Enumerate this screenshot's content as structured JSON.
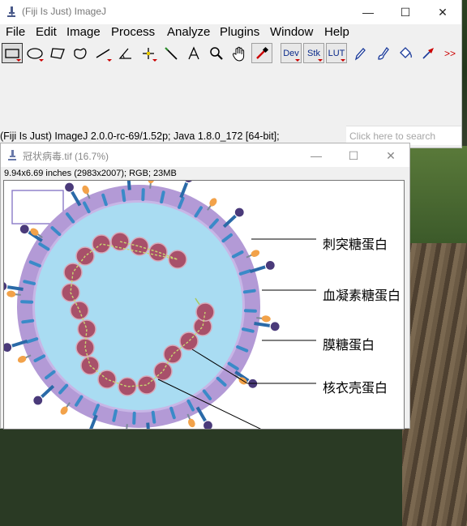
{
  "app": {
    "title": "(Fiji Is Just) ImageJ",
    "window_controls": {
      "minimize": "—",
      "maximize": "☐",
      "close": "✕"
    }
  },
  "menu": [
    "File",
    "Edit",
    "Image",
    "Process",
    "Analyze",
    "Plugins",
    "Window",
    "Help"
  ],
  "toolbar": {
    "tools": [
      {
        "name": "rectangle-tool"
      },
      {
        "name": "oval-tool"
      },
      {
        "name": "polygon-tool"
      },
      {
        "name": "freehand-tool"
      },
      {
        "name": "line-tool"
      },
      {
        "name": "angle-tool"
      },
      {
        "name": "point-tool"
      },
      {
        "name": "wand-tool"
      },
      {
        "name": "text-tool"
      },
      {
        "name": "magnifier-tool"
      },
      {
        "name": "scroll-tool"
      },
      {
        "name": "color-picker-tool"
      }
    ],
    "dev_label": "Dev",
    "stk_label": "Stk",
    "lut_label": "LUT",
    "more_label": ">>"
  },
  "status": "(Fiji Is Just) ImageJ 2.0.0-rc-69/1.52p; Java 1.8.0_172 [64-bit];",
  "search": {
    "placeholder": "Click here to search"
  },
  "image_window": {
    "title": "冠状病毒.tif (16.7%)",
    "info": "9.94x6.69 inches (2983x2007); RGB; 23MB",
    "window_controls": {
      "minimize": "—",
      "maximize": "☐",
      "close": "✕"
    }
  },
  "figure_labels": {
    "spike": "刺突糖蛋白",
    "hemagglutinin": "血凝素糖蛋白",
    "membrane": "膜糖蛋白",
    "nucleocapsid": "核衣壳蛋白"
  },
  "colors": {
    "envelope": "#b39ad6",
    "interior": "#a9dcf2",
    "rna_bead": "#a8506a",
    "spike_stem": "#2a6aa8",
    "spike_head": "#4a3a7a",
    "he_head": "#f2a24a"
  }
}
